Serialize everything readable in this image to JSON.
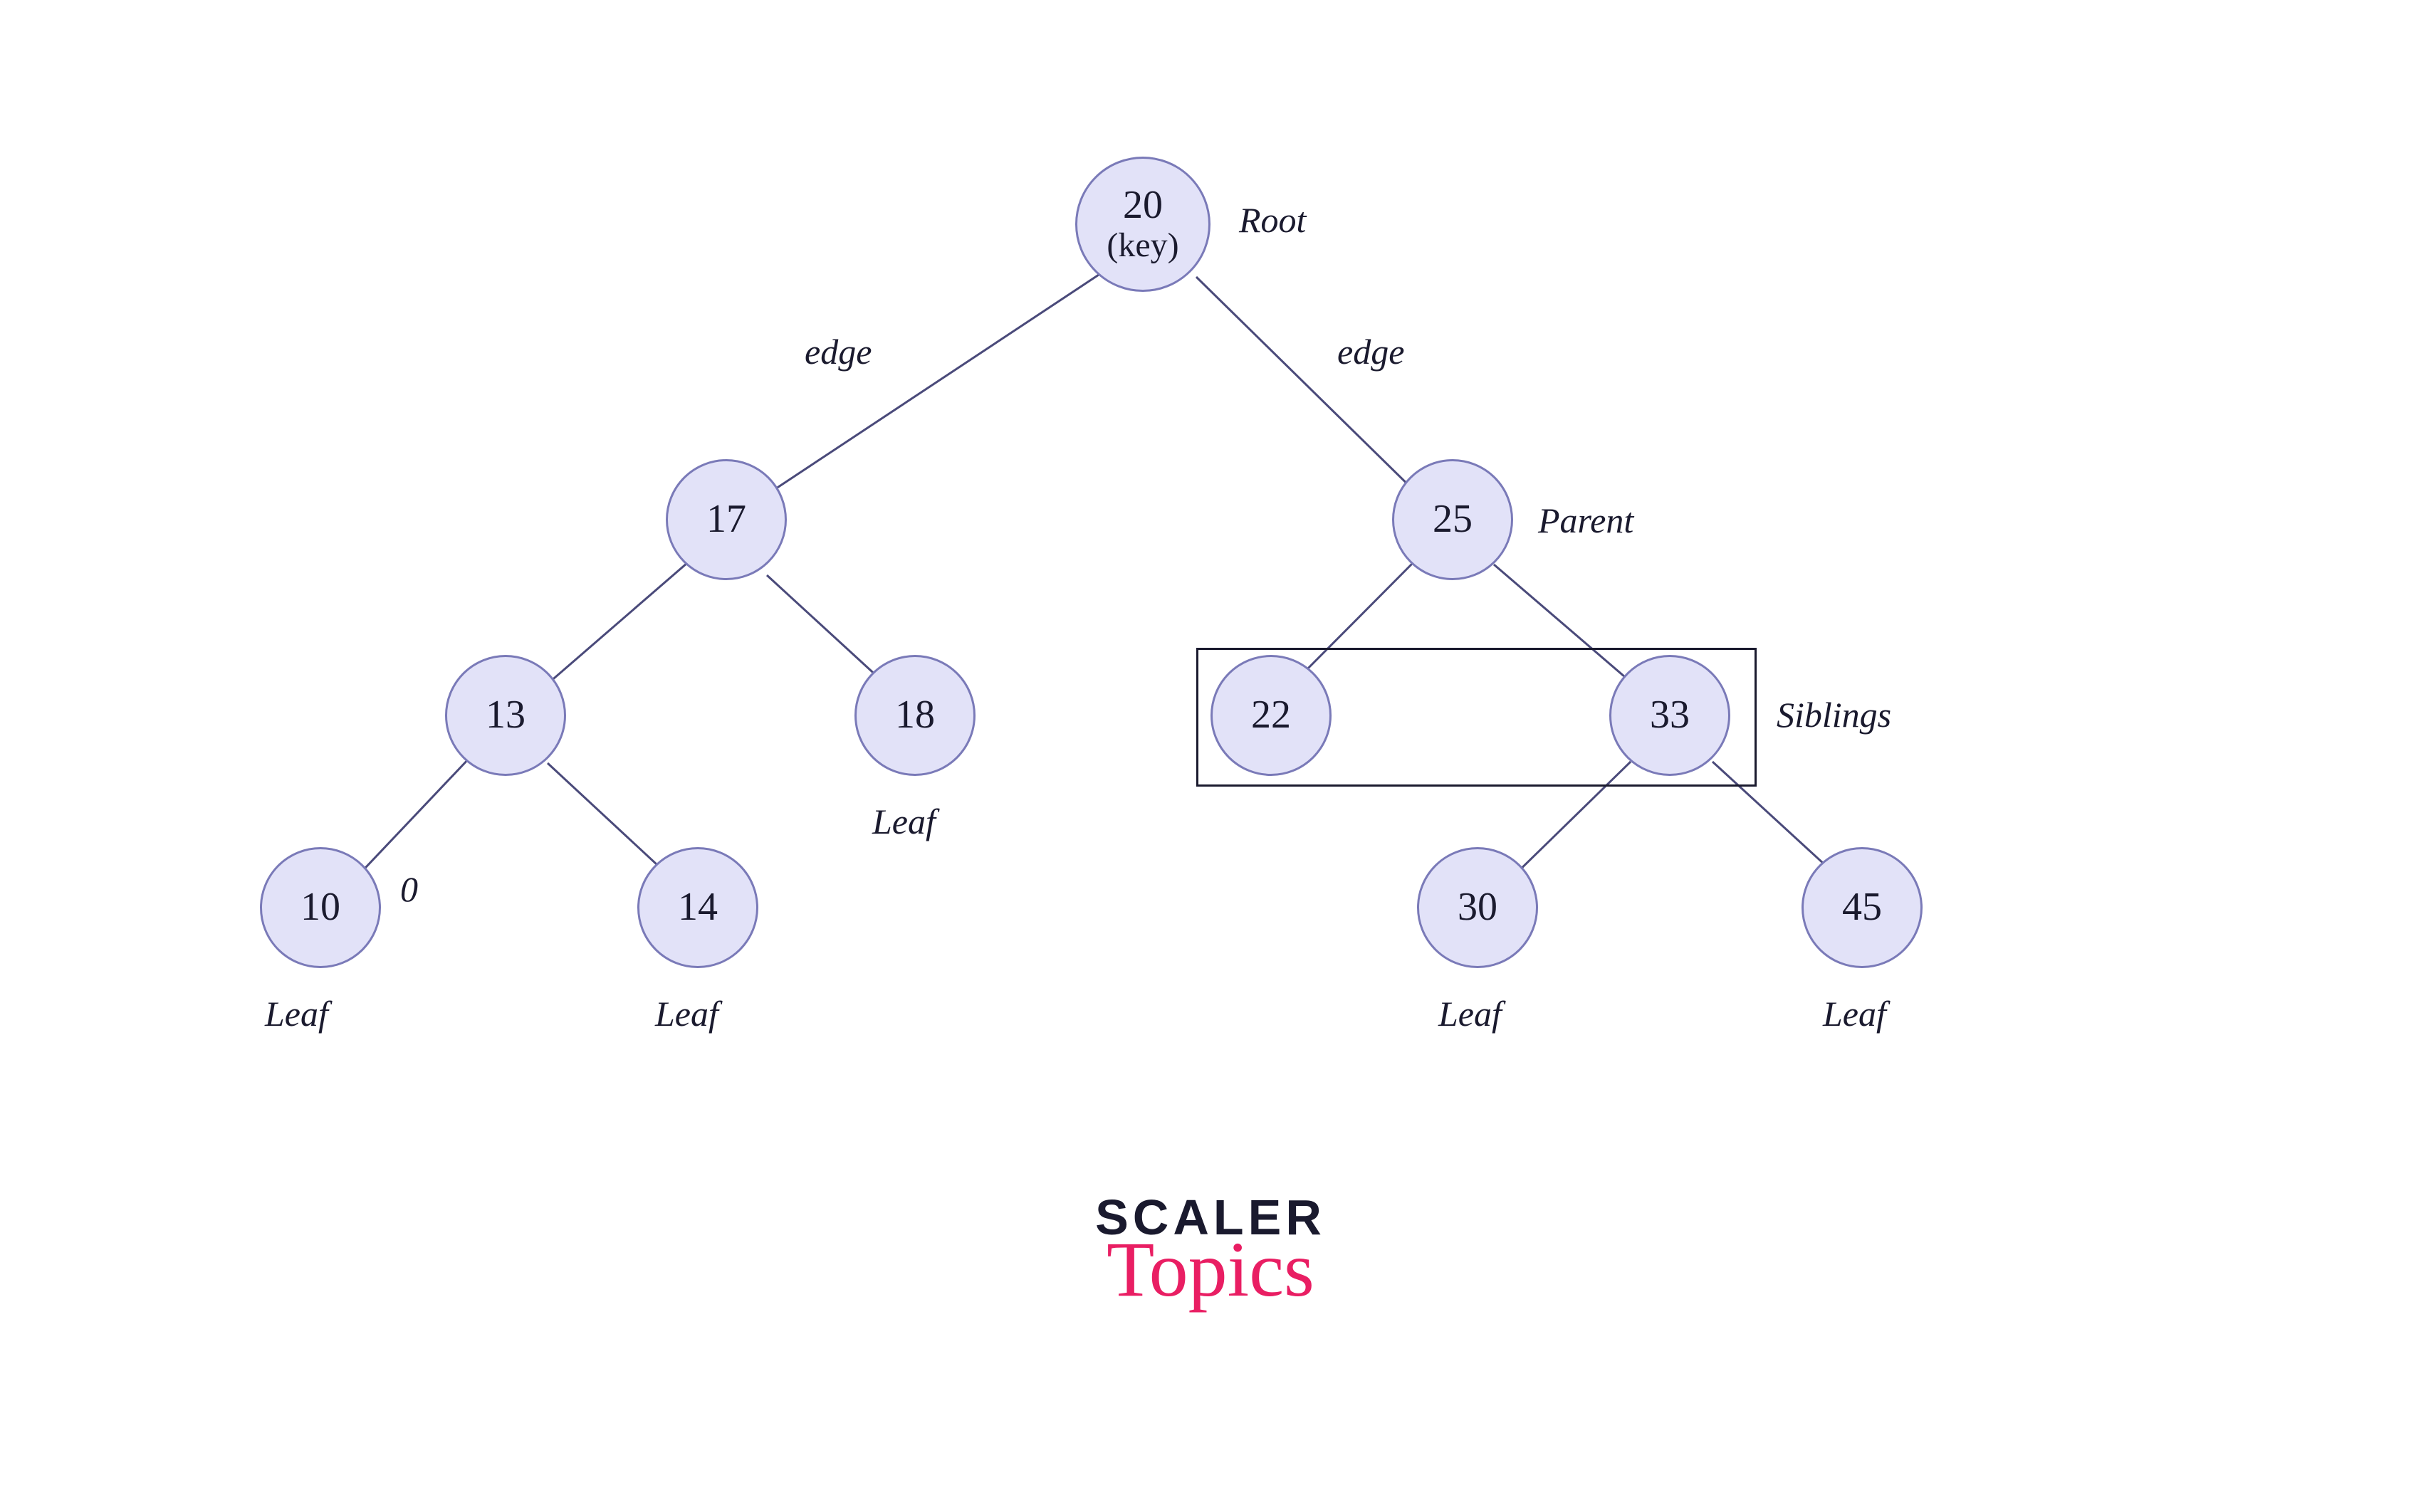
{
  "colors": {
    "nodeFill": "#e2e2f8",
    "nodeStroke": "#7a7ab8",
    "edgeStroke": "#4a4a7a",
    "text": "#1a1a2e",
    "logoPrimary": "#1a1a2e",
    "logoAccent": "#e91e63"
  },
  "nodes": {
    "root": {
      "value": "20",
      "sub": "(key)"
    },
    "n17": {
      "value": "17"
    },
    "n25": {
      "value": "25"
    },
    "n13": {
      "value": "13"
    },
    "n18": {
      "value": "18"
    },
    "n22": {
      "value": "22"
    },
    "n33": {
      "value": "33"
    },
    "n10": {
      "value": "10"
    },
    "n14": {
      "value": "14"
    },
    "n30": {
      "value": "30"
    },
    "n45": {
      "value": "45"
    }
  },
  "labels": {
    "root": "Root",
    "edgeLeft": "edge",
    "edgeRight": "edge",
    "parent": "Parent",
    "siblings": "Siblings",
    "zero": "0",
    "leaf10": "Leaf",
    "leaf14": "Leaf",
    "leaf18": "Leaf",
    "leaf30": "Leaf",
    "leaf45": "Leaf"
  },
  "logo": {
    "line1": "SCALER",
    "line2": "Topics"
  }
}
